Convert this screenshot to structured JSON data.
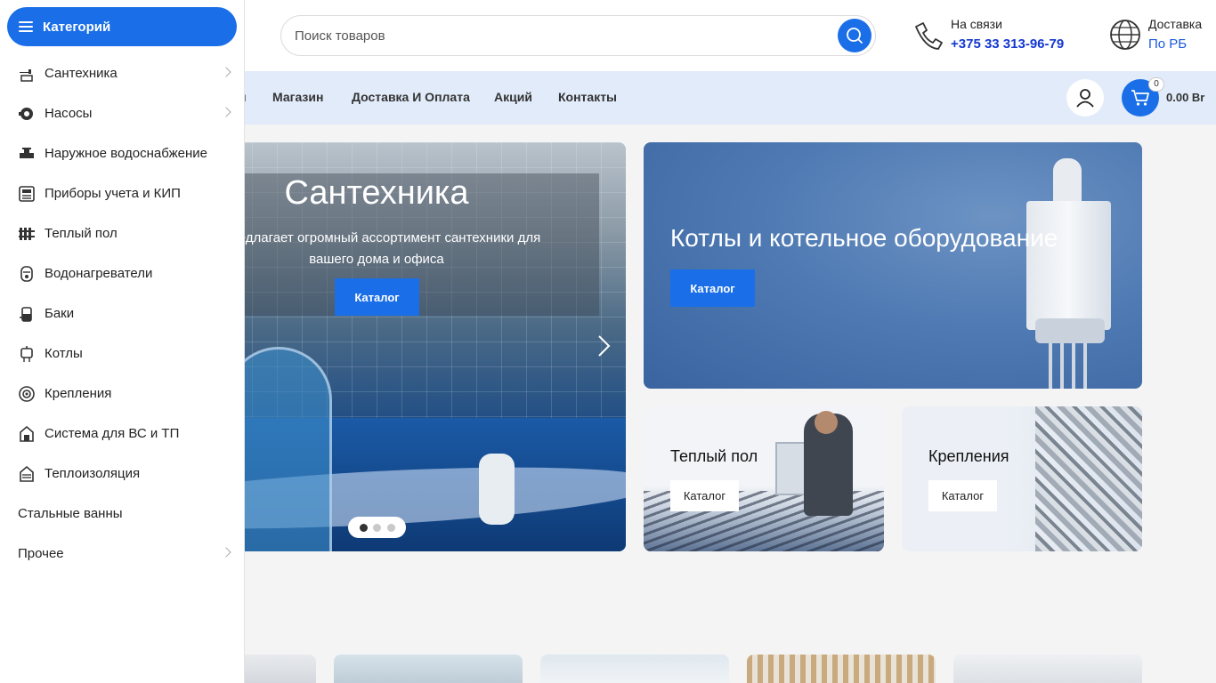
{
  "header": {
    "search_placeholder": "Поиск товаров",
    "contact": {
      "label": "На связи",
      "phone": "+375 33 313-96-79"
    },
    "delivery": {
      "label": "Доставка",
      "value": "По РБ"
    }
  },
  "nav": {
    "partial_item": "и",
    "items": [
      "Магазин",
      "Доставка И Оплата",
      "Акций",
      "Контакты"
    ],
    "cart_count": "0",
    "cart_total": "0.00 Br"
  },
  "slider": {
    "title": "Сантехника",
    "text_line1": "н предлагает огромный ассортимент сантехники для",
    "text_line2": "вашего дома и офиса",
    "button": "Каталог",
    "dots": 3,
    "active_dot": 1
  },
  "banners": {
    "boiler": {
      "title": "Котлы и котельное оборудование",
      "button": "Каталог"
    },
    "floor": {
      "title": "Теплый пол",
      "button": "Каталог"
    },
    "bolts": {
      "title": "Крепления",
      "button": "Каталог"
    }
  },
  "sidebar": {
    "toggle_label": "Категорий",
    "items": [
      {
        "label": "Сантехника",
        "icon": "faucet-icon",
        "has_submenu": true
      },
      {
        "label": "Насосы",
        "icon": "pump-icon",
        "has_submenu": true
      },
      {
        "label": "Наружное водоснабжение",
        "icon": "water-supply-icon",
        "has_submenu": false
      },
      {
        "label": "Приборы учета и КИП",
        "icon": "meter-icon",
        "has_submenu": false
      },
      {
        "label": "Теплый пол",
        "icon": "radiator-icon",
        "has_submenu": false
      },
      {
        "label": "Водонагреватели",
        "icon": "water-heater-icon",
        "has_submenu": false
      },
      {
        "label": "Баки",
        "icon": "tank-icon",
        "has_submenu": false
      },
      {
        "label": "Котлы",
        "icon": "boiler-icon",
        "has_submenu": false
      },
      {
        "label": "Крепления",
        "icon": "fastener-icon",
        "has_submenu": false
      },
      {
        "label": "Система для ВС и ТП",
        "icon": "pipe-system-icon",
        "has_submenu": false
      },
      {
        "label": "Теплоизоляция",
        "icon": "insulation-icon",
        "has_submenu": false
      },
      {
        "label": "Стальные ванны",
        "icon": "",
        "has_submenu": false
      },
      {
        "label": "Прочее",
        "icon": "",
        "has_submenu": true
      }
    ]
  },
  "colors": {
    "accent": "#1a6fe8",
    "nav_bg": "#e1ebfa",
    "link": "#1337d1"
  }
}
